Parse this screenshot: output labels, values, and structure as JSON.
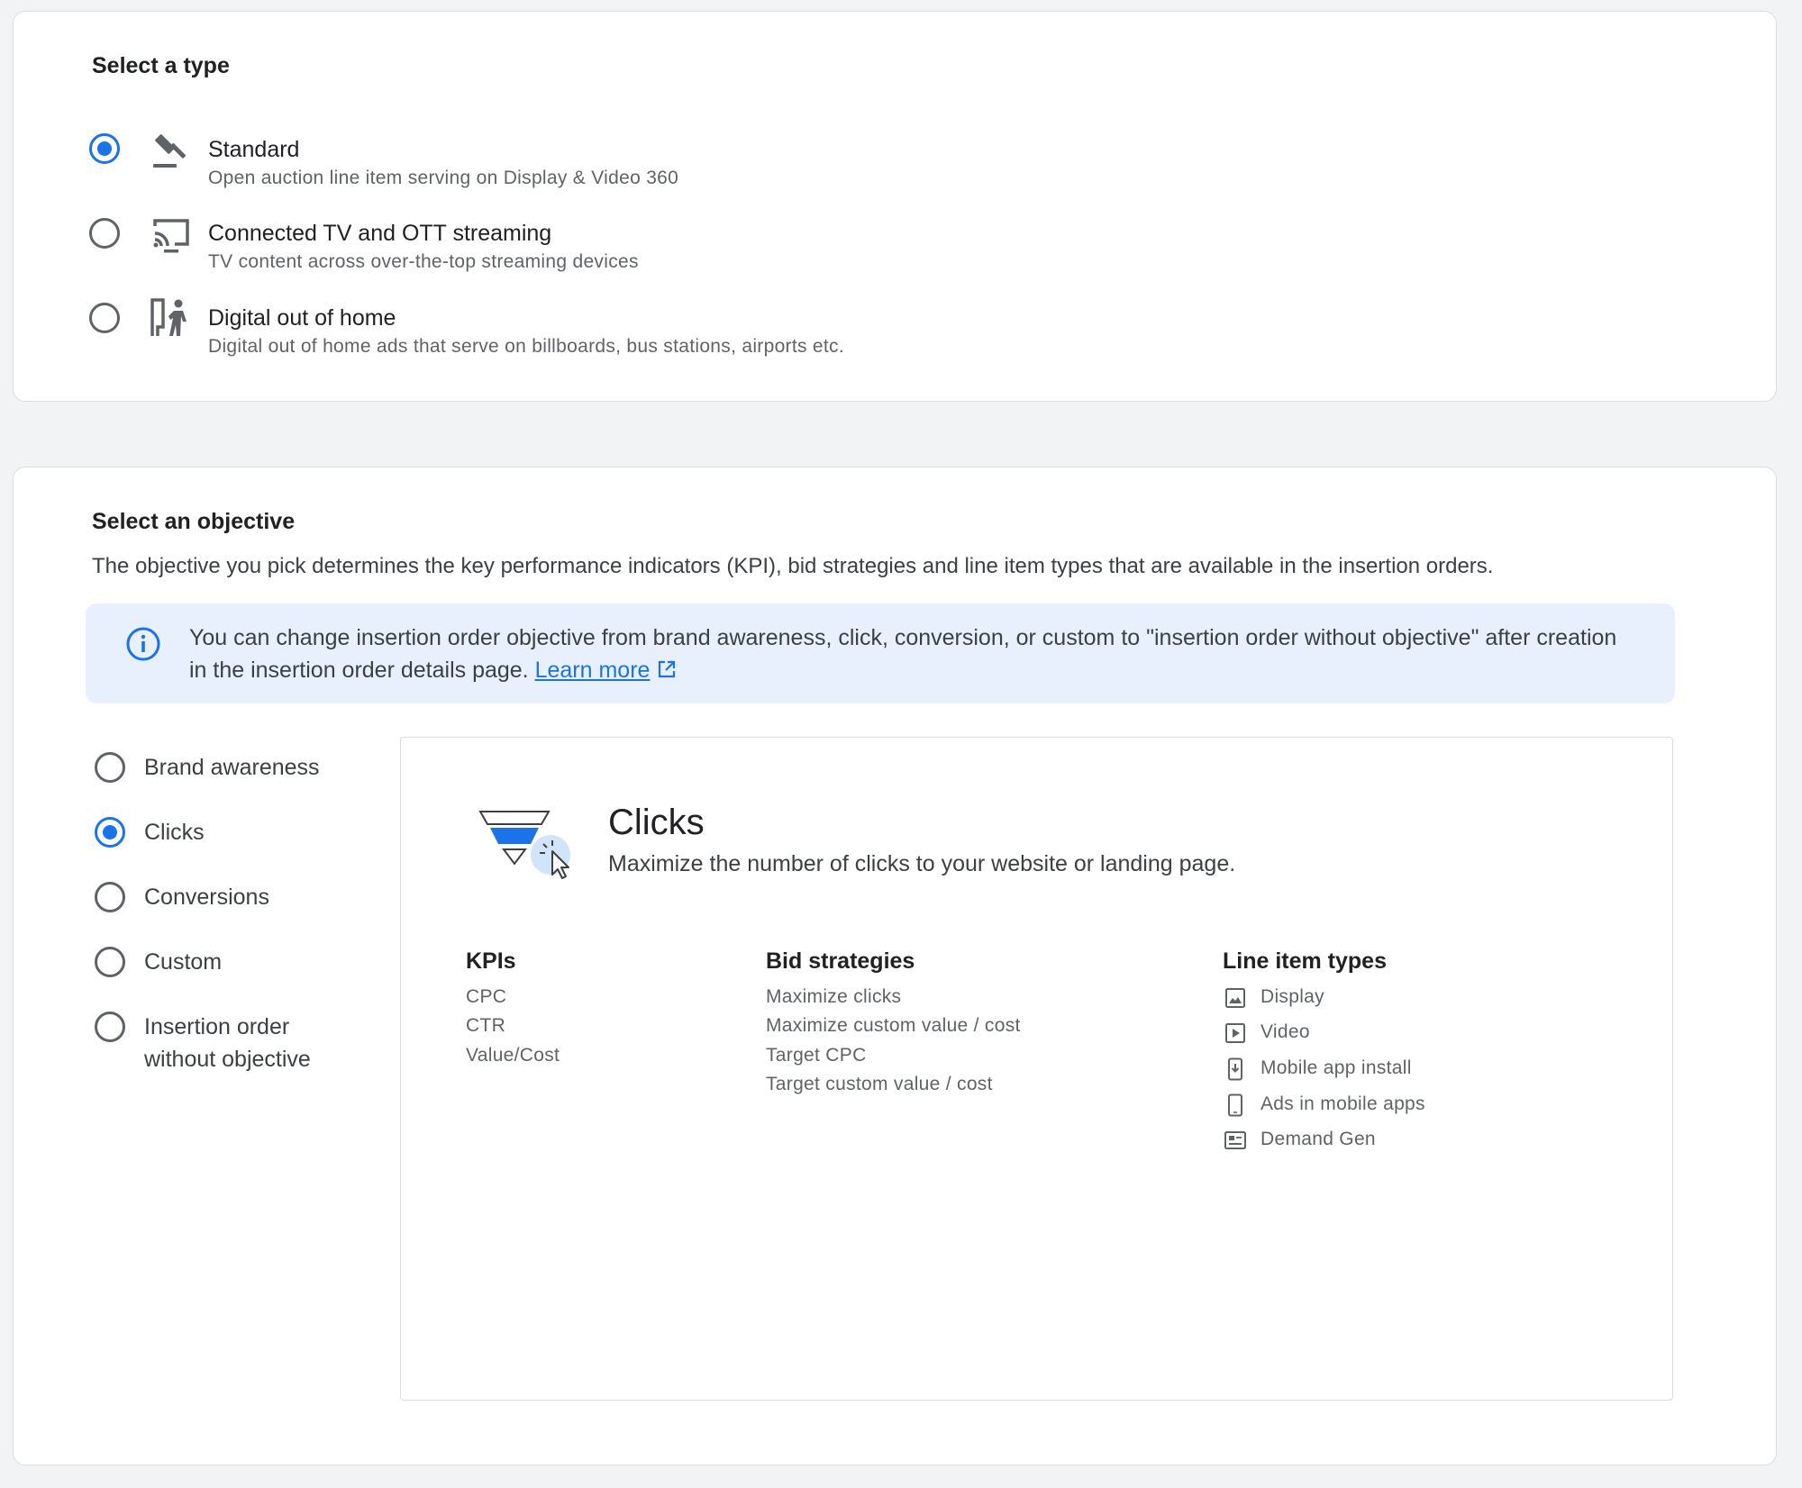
{
  "type_section": {
    "title": "Select a type",
    "options": [
      {
        "title": "Standard",
        "description": "Open auction line item serving on Display & Video 360",
        "icon": "gavel-icon",
        "selected": true
      },
      {
        "title": "Connected TV and OTT streaming",
        "description": "TV content across over-the-top streaming devices",
        "icon": "cast-tv-icon",
        "selected": false
      },
      {
        "title": "Digital out of home",
        "description": "Digital out of home ads that serve on billboards, bus stations, airports etc.",
        "icon": "pedestrian-billboard-icon",
        "selected": false
      }
    ]
  },
  "objective_section": {
    "title": "Select an objective",
    "description": "The objective you pick determines the key performance indicators (KPI), bid strategies and line item types that are available in the insertion orders.",
    "info": {
      "text": "You can change insertion order objective from brand awareness, click, conversion, or custom to \"insertion order without objective\" after creation in the insertion order details page.",
      "link_label": "Learn more"
    },
    "options": [
      {
        "label": "Brand awareness",
        "selected": false
      },
      {
        "label": "Clicks",
        "selected": true
      },
      {
        "label": "Conversions",
        "selected": false
      },
      {
        "label": "Custom",
        "selected": false
      },
      {
        "label_line1": "Insertion order",
        "label_line2": "without objective",
        "selected": false
      }
    ],
    "detail": {
      "title": "Clicks",
      "subtitle": "Maximize the number of clicks to your website or landing page.",
      "kpis": {
        "heading": "KPIs",
        "items": [
          "CPC",
          "CTR",
          "Value/Cost"
        ]
      },
      "bid_strategies": {
        "heading": "Bid strategies",
        "items": [
          "Maximize clicks",
          "Maximize custom value / cost",
          "Target CPC",
          "Target custom value / cost"
        ]
      },
      "line_item_types": {
        "heading": "Line item types",
        "items": [
          {
            "label": "Display",
            "icon": "image-icon"
          },
          {
            "label": "Video",
            "icon": "play-icon"
          },
          {
            "label": "Mobile app install",
            "icon": "mobile-download-icon"
          },
          {
            "label": "Ads in mobile apps",
            "icon": "mobile-icon"
          },
          {
            "label": "Demand Gen",
            "icon": "demand-gen-icon"
          }
        ]
      }
    }
  },
  "colors": {
    "accent": "#1a73e8",
    "info_bg": "#e8f0fe",
    "page_bg": "#f1f3f4"
  }
}
